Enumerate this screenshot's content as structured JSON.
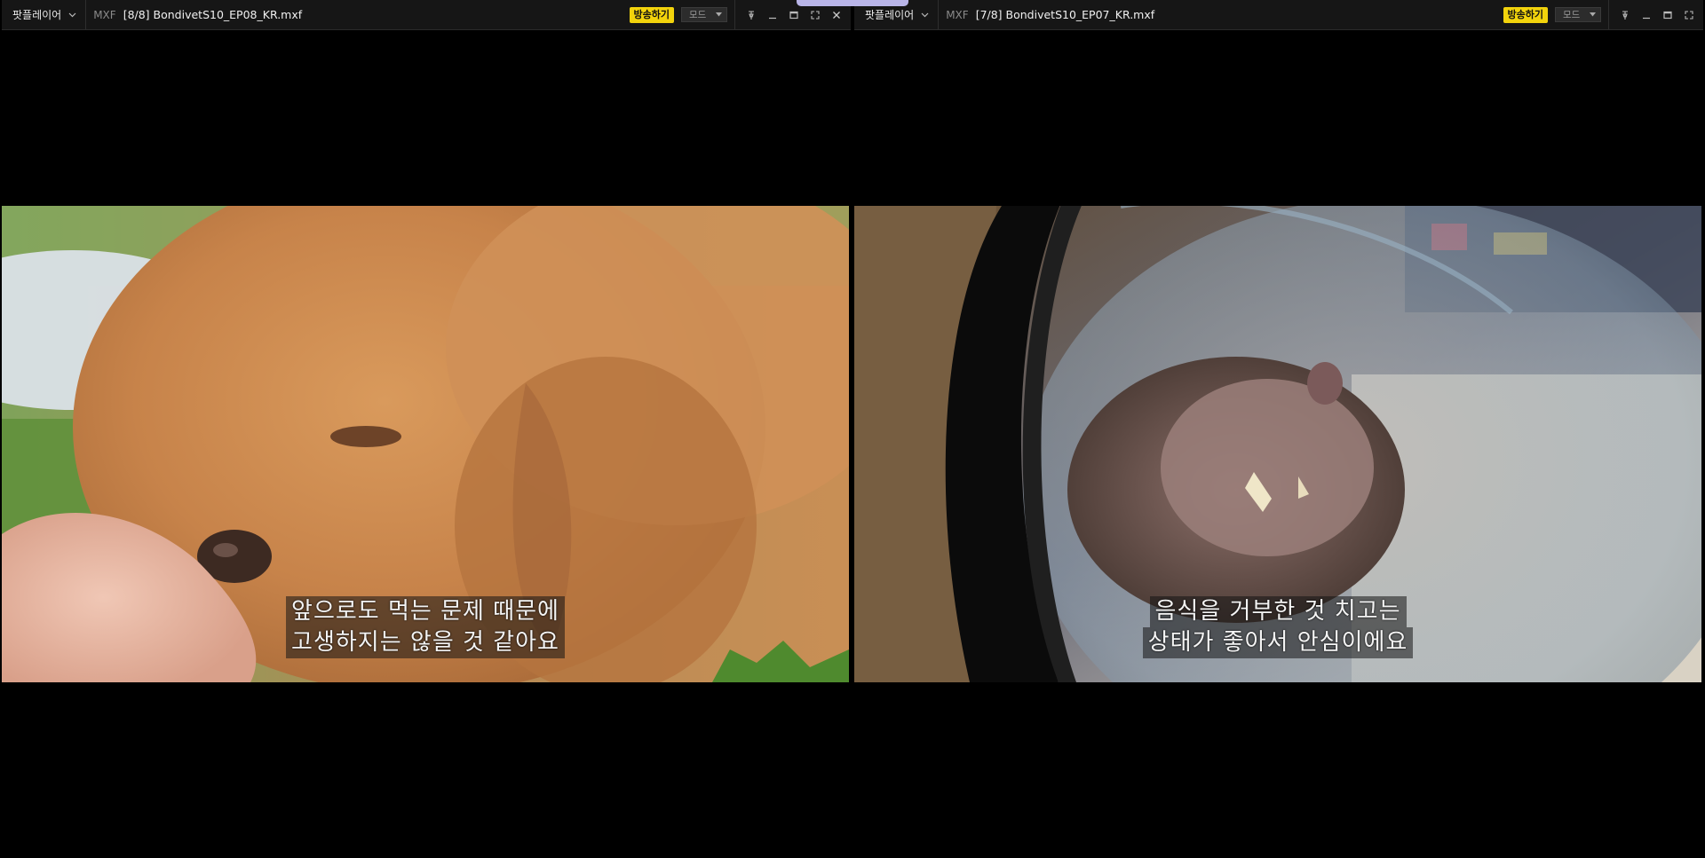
{
  "panes": [
    {
      "player_label": "팟플레이어",
      "format": "MXF",
      "filename": "[8/8] BondivetS10_EP08_KR.mxf",
      "broadcast_label": "방송하기",
      "mode_label": "모드",
      "subtitle": {
        "line1": "앞으로도 먹는 문제 때문에",
        "line2": "고생하지는 않을 것 같아요"
      }
    },
    {
      "player_label": "팟플레이어",
      "format": "MXF",
      "filename": "[7/8] BondivetS10_EP07_KR.mxf",
      "broadcast_label": "방송하기",
      "mode_label": "모드",
      "subtitle": {
        "line1": "음식을 거부한 것 치고는",
        "line2": "상태가 좋아서 안심이에요"
      }
    }
  ],
  "icons": {
    "pin": "pin-icon",
    "minimize": "minimize-icon",
    "maximize": "maximize-icon",
    "fullscreen": "fullscreen-icon",
    "close": "close-icon"
  },
  "colors": {
    "broadcast": "#f2d30c",
    "titlebar": "#161616"
  }
}
